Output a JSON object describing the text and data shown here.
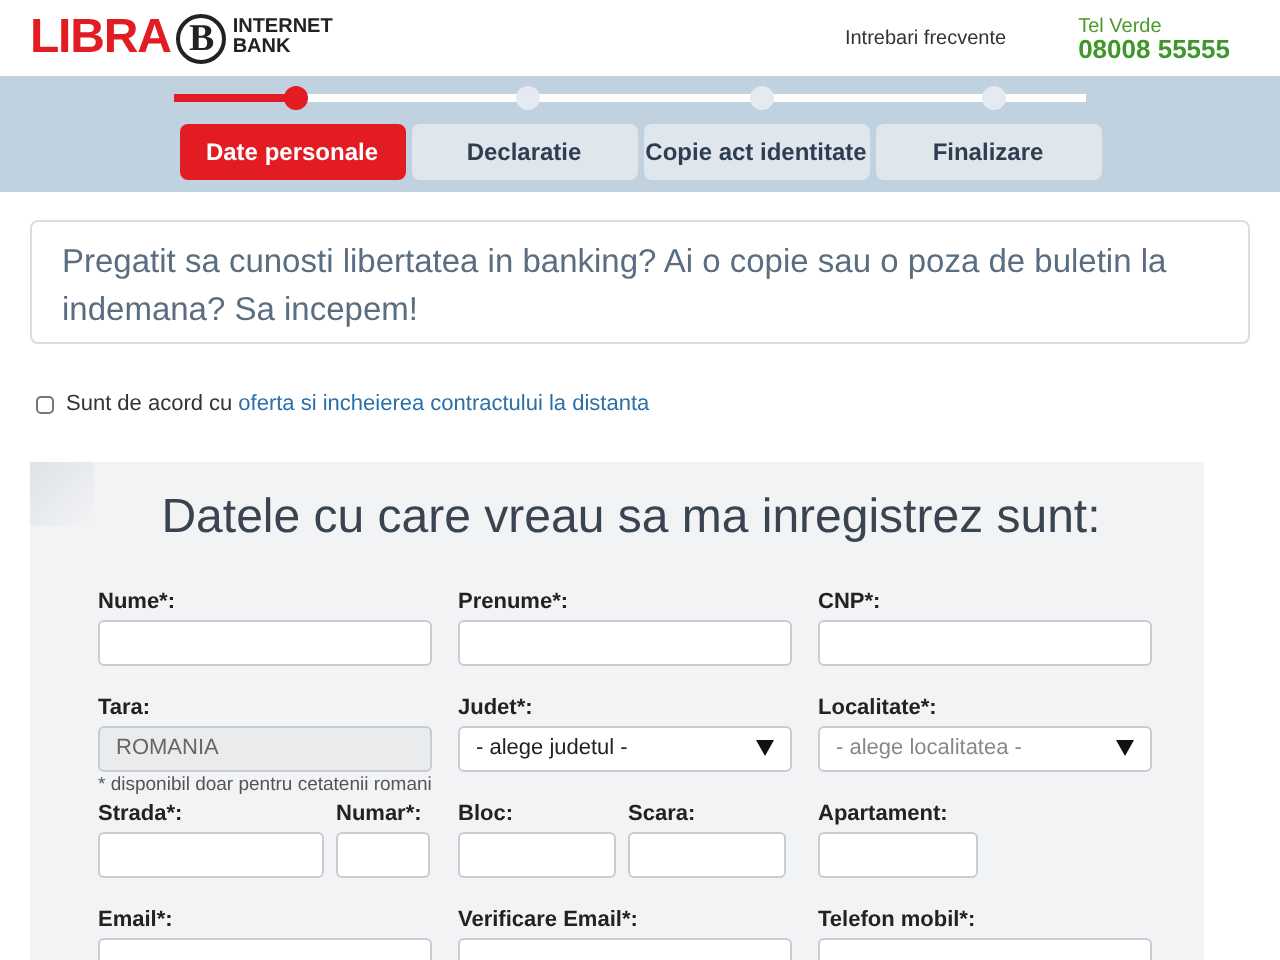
{
  "header": {
    "logo_word": "LIBRA",
    "logo_letter": "B",
    "logo_sub": [
      "INTERNET",
      "BANK"
    ],
    "faq_link": "Intrebari frecvente",
    "hotline_label": "Tel Verde",
    "hotline_number": "08008 55555"
  },
  "steps": [
    {
      "label": "Date personale",
      "selected": true
    },
    {
      "label": "Declaratie",
      "selected": false
    },
    {
      "label": "Copie act identitate",
      "selected": false
    },
    {
      "label": "Finalizare",
      "selected": false
    }
  ],
  "intro": "Pregatit sa cunosti libertatea in banking? Ai o copie sau o poza de buletin la indemana? Sa incepem!",
  "consent": {
    "checked": false,
    "text": "Sunt de acord cu",
    "link": "oferta si incheierea contractului la distanta"
  },
  "form": {
    "title": "Datele cu care vreau sa ma inregistrez sunt:",
    "rows": [
      [
        [
          {
            "label": "Nume*:",
            "kind": "text"
          }
        ],
        [
          {
            "label": "Prenume*:",
            "kind": "text"
          }
        ],
        [
          {
            "label": "CNP*:",
            "kind": "text"
          }
        ]
      ],
      [
        [
          {
            "label": "Tara:",
            "kind": "readonly",
            "value": "ROMANIA",
            "note": "* disponibil doar pentru cetatenii romani"
          }
        ],
        [
          {
            "label": "Judet*:",
            "kind": "select",
            "value": "- alege judetul -",
            "disabled": false
          }
        ],
        [
          {
            "label": "Localitate*:",
            "kind": "select",
            "value": "- alege localitatea -",
            "disabled": true
          }
        ]
      ],
      [
        [
          {
            "label": "Strada*:",
            "kind": "text"
          },
          {
            "label": "Numar*:",
            "kind": "text"
          }
        ],
        [
          {
            "label": "Bloc:",
            "kind": "text"
          },
          {
            "label": "Scara:",
            "kind": "text"
          }
        ],
        [
          {
            "label": "Apartament:",
            "kind": "text"
          }
        ]
      ],
      [
        [
          {
            "label": "Email*:",
            "kind": "text"
          }
        ],
        [
          {
            "label": "Verificare Email*:",
            "kind": "text"
          }
        ],
        [
          {
            "label": "Telefon mobil*:",
            "kind": "text"
          }
        ]
      ]
    ]
  }
}
